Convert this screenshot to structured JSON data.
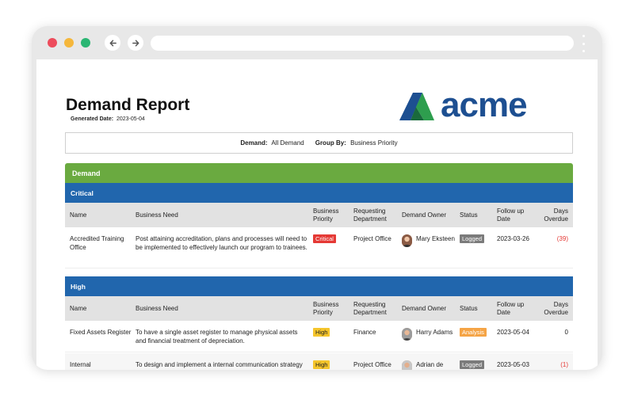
{
  "report": {
    "title": "Demand Report",
    "generated_label": "Generated Date:",
    "generated_value": "2023-05-04",
    "logo_text": "acme"
  },
  "filters": {
    "demand_label": "Demand:",
    "demand_value": "All Demand",
    "group_label": "Group By:",
    "group_value": "Business Priority"
  },
  "section_title": "Demand",
  "columns": {
    "name": "Name",
    "need": "Business Need",
    "priority_1": "Business",
    "priority_2": "Priority",
    "rdept_1": "Requesting",
    "rdept_2": "Department",
    "owner": "Demand Owner",
    "status": "Status",
    "fup_1": "Follow up",
    "fup_2": "Date",
    "days_1": "Days",
    "days_2": "Overdue"
  },
  "groups": [
    {
      "title": "Critical",
      "rows": [
        {
          "name": "Accredited Training Office",
          "need": "Post attaining accreditation, plans and processes will need to be implemented to effectively launch our program to trainees.",
          "priority": "Critical",
          "department": "Project Office",
          "owner": "Mary Eksteen",
          "status": "Logged",
          "followup": "2023-03-26",
          "days": "(39)"
        }
      ]
    },
    {
      "title": "High",
      "rows": [
        {
          "name": "Fixed Assets Register",
          "need": "To have a single asset register to manage physical assets and financial treatment of depreciation.",
          "priority": "High",
          "department": "Finance",
          "owner": "Harry Adams",
          "status": "Analysis",
          "followup": "2023-05-04",
          "days": "0"
        },
        {
          "name": "Internal Communications Strategy",
          "need": "To design and implement  a internal communication strategy and plan to support the business",
          "priority": "High",
          "department": "Project Office",
          "owner": "Adrian de Villiers",
          "status": "Logged",
          "followup": "2023-05-03",
          "days": "(1)"
        }
      ]
    }
  ],
  "colors": {
    "demand_band": "#6aaa40",
    "group_band": "#2166ad",
    "critical": "#e53935",
    "high": "#f5c52c",
    "logged": "#7b7b7b",
    "analysis": "#f5a445",
    "logo_dark": "#1d4f91",
    "logo_green": "#2e9e4e"
  },
  "icons": {
    "back": "arrow-left-icon",
    "forward": "arrow-right-icon",
    "menu": "kebab-menu-icon"
  }
}
